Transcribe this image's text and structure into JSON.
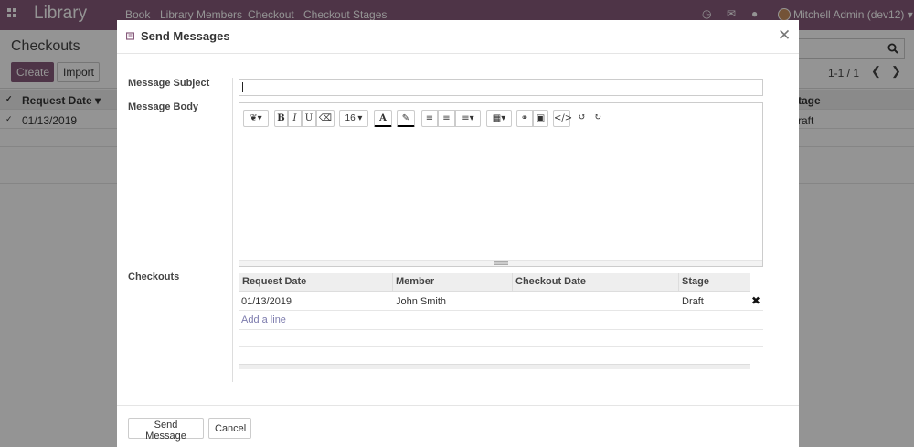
{
  "app": {
    "name": "Library",
    "menu": [
      "Book",
      "Library Members",
      "Checkout",
      "Checkout Stages"
    ],
    "user": "Mitchell Admin (dev12)",
    "brand_color": "#875A7B"
  },
  "control_panel": {
    "breadcrumb": "Checkouts",
    "create_label": "Create",
    "import_label": "Import",
    "pager": "1-1 / 1"
  },
  "background_list": {
    "header_request_date": "Request Date",
    "header_stage": "tage",
    "row_request_date": "01/13/2019",
    "row_stage": "raft"
  },
  "dialog": {
    "title": "Send Messages",
    "subject_label": "Message Subject",
    "subject_value": "",
    "body_label": "Message Body",
    "font_size": "16",
    "checkouts_label": "Checkouts",
    "columns": [
      "Request Date",
      "Member",
      "Checkout Date",
      "Stage"
    ],
    "rows": [
      {
        "request_date": "01/13/2019",
        "member": "John Smith",
        "checkout_date": "",
        "stage": "Draft"
      }
    ],
    "add_line": "Add a line",
    "send_label": "Send Message",
    "cancel_label": "Cancel"
  },
  "icons": {
    "apps": "apps-grid-icon",
    "close": "close-icon",
    "delete": "delete-row-icon",
    "search": "search-icon"
  }
}
